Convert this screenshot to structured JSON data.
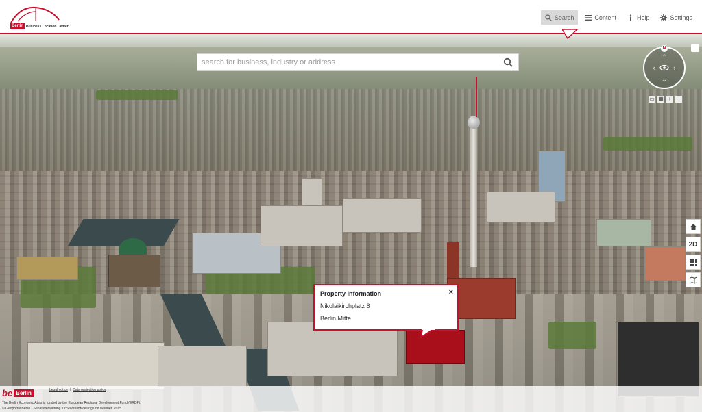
{
  "header": {
    "logo": {
      "brand": "Berlin",
      "subtitle": "Business Location Center"
    },
    "nav": [
      {
        "label": "Search",
        "icon": "search-icon",
        "active": true
      },
      {
        "label": "Content",
        "icon": "menu-icon",
        "active": false
      },
      {
        "label": "Help",
        "icon": "info-icon",
        "active": false
      },
      {
        "label": "Settings",
        "icon": "gear-icon",
        "active": false
      }
    ]
  },
  "search": {
    "placeholder": "search for business, industry or address",
    "value": ""
  },
  "compass": {
    "north_label": "N"
  },
  "side_controls": [
    {
      "name": "home-button",
      "label": "",
      "icon": "home-icon"
    },
    {
      "name": "view-2d-button",
      "label": "2D",
      "icon": ""
    },
    {
      "name": "grid-button",
      "label": "",
      "icon": "grid-icon"
    },
    {
      "name": "map-button",
      "label": "",
      "icon": "map-icon"
    }
  ],
  "popup": {
    "title": "Property information",
    "close": "×",
    "address": "Nikolaikirchplatz 8",
    "district": "Berlin Mitte"
  },
  "footer": {
    "be": "be",
    "berlin": "Berlin",
    "legal_notice": "Legal notice",
    "separator": "|",
    "data_protection": "Data protection policy",
    "funding_note": "The Berlin Economic Atlas is funded by the European Regional Development Fund (ERDF).",
    "copyright": "© Geoportal Berlin - Senatsverwaltung für Stadtentwicklung und Wohnen 2015"
  },
  "colors": {
    "accent": "#c8102e",
    "header_bg": "#ffffff",
    "active_nav_bg": "#d9d9d9"
  }
}
